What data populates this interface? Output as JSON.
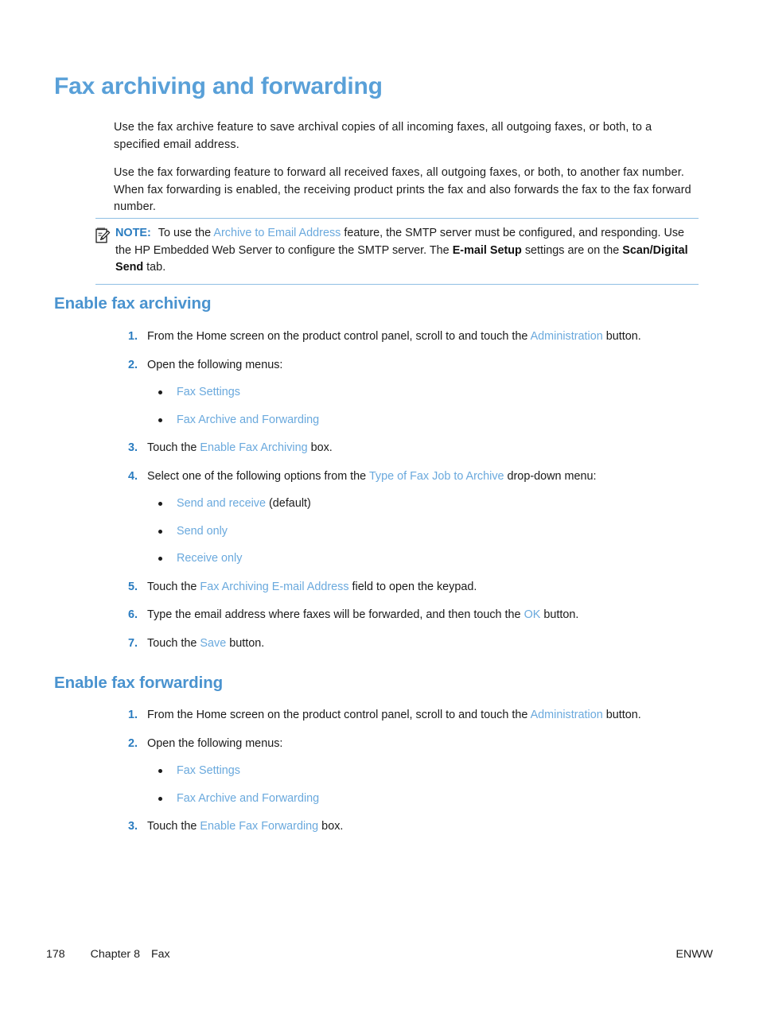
{
  "document": {
    "title": "Fax archiving and forwarding"
  },
  "intro": {
    "paragraph_1": "Use the fax archive feature to save archival copies of all incoming faxes, all outgoing faxes, or both, to a specified email address.",
    "paragraph_2": "Use the fax forwarding feature to forward all received faxes, all outgoing faxes, or both, to another fax number. When fax forwarding is enabled, the receiving product prints the fax and also forwards the fax to the fax forward number."
  },
  "note": {
    "icon": "note-pencil-icon",
    "label": "NOTE:",
    "text_1": "To use the ",
    "link_1": "Archive to Email Address",
    "text_2": " feature, the SMTP server must be configured, and responding. Use the HP Embedded Web Server to configure the SMTP server. The ",
    "bold_1": "E-mail Setup",
    "text_3": " settings are on the ",
    "bold_2": "Scan/Digital Send",
    "text_4": " tab."
  },
  "section_archiving": {
    "heading": "Enable fax archiving",
    "steps": [
      {
        "num": "1.",
        "text_1": "From the Home screen on the product control panel, scroll to and touch the ",
        "link": "Administration",
        "text_2": " button."
      },
      {
        "num": "2.",
        "text_1": "Open the following menus:",
        "bullets": [
          {
            "link": "Fax Settings"
          },
          {
            "link": "Fax Archive and Forwarding"
          }
        ]
      },
      {
        "num": "3.",
        "text_1": "Touch the ",
        "link": "Enable Fax Archiving",
        "text_2": " box."
      },
      {
        "num": "4.",
        "text_1": "Select one of the following options from the ",
        "link": "Type of Fax Job to Archive",
        "text_2": " drop-down menu:",
        "bullets": [
          {
            "link": "Send and receive",
            "suffix": " (default)"
          },
          {
            "link": "Send only",
            "suffix": ""
          },
          {
            "link": "Receive only",
            "suffix": ""
          }
        ]
      },
      {
        "num": "5.",
        "text_1": "Touch the ",
        "link": "Fax Archiving E-mail Address",
        "text_2": " field to open the keypad."
      },
      {
        "num": "6.",
        "text_1": "Type the email address where faxes will be forwarded, and then touch the ",
        "link": "OK",
        "text_2": " button."
      },
      {
        "num": "7.",
        "text_1": "Touch the ",
        "link": "Save",
        "text_2": " button."
      }
    ]
  },
  "section_forwarding": {
    "heading": "Enable fax forwarding",
    "steps": [
      {
        "num": "1.",
        "text_1": "From the Home screen on the product control panel, scroll to and touch the ",
        "link": "Administration",
        "text_2": " button."
      },
      {
        "num": "2.",
        "text_1": "Open the following menus:",
        "bullets": [
          {
            "link": "Fax Settings"
          },
          {
            "link": "Fax Archive and Forwarding"
          }
        ]
      },
      {
        "num": "3.",
        "text_1": "Touch the ",
        "link": "Enable Fax Forwarding",
        "text_2": " box."
      }
    ]
  },
  "footer": {
    "page_number": "178",
    "chapter": "Chapter 8",
    "chapter_title": "Fax",
    "right_label": "ENWW"
  },
  "colors": {
    "heading_blue": "#59a0d8",
    "subheading_blue": "#4a93cf",
    "link_blue": "#6aa9dd",
    "accent_blue": "#2a7cc0",
    "rule_blue": "#8fbfe4",
    "body_text": "#1c1c1c"
  }
}
